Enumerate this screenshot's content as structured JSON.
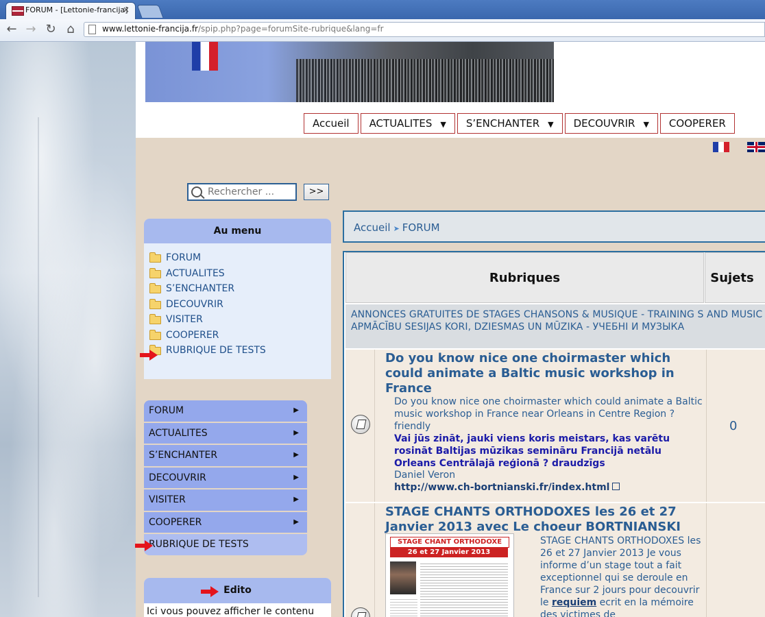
{
  "browser": {
    "tab_title": "FORUM - [Lettonie-francija]",
    "tab_close": "×",
    "url_host": "www.lettonie-francija.fr",
    "url_path": "/spip.php?page=forumSite-rubrique&lang=fr"
  },
  "main_menu": [
    {
      "label": "Accueil",
      "has_dropdown": false
    },
    {
      "label": "ACTUALITES",
      "has_dropdown": true
    },
    {
      "label": "S’ENCHANTER",
      "has_dropdown": true
    },
    {
      "label": "DECOUVRIR",
      "has_dropdown": true
    },
    {
      "label": "COOPERER",
      "has_dropdown": false
    }
  ],
  "dropdown_glyph": "▼",
  "search": {
    "placeholder": "Rechercher ...",
    "button_label": ">>"
  },
  "au_menu": {
    "title": "Au menu",
    "items": [
      "FORUM",
      "ACTUALITES",
      "S’ENCHANTER",
      "DECOUVRIR",
      "VISITER",
      "COOPERER",
      "RUBRIQUE DE TESTS"
    ]
  },
  "side_nav": {
    "items": [
      "FORUM",
      "ACTUALITES",
      "S’ENCHANTER",
      "DECOUVRIR",
      "VISITER",
      "COOPERER",
      "RUBRIQUE DE TESTS"
    ],
    "arrow_glyph": "▶"
  },
  "edito": {
    "title": "Edito",
    "text": "Ici vous pouvez afficher le contenu"
  },
  "breadcrumb": {
    "home": "Accueil",
    "current": "FORUM",
    "sep": "➤"
  },
  "forum": {
    "col_rubriques": "Rubriques",
    "col_sujets": "Sujets",
    "section_title": "ANNONCES GRATUITES DE STAGES CHANSONS & MUSIQUE - TRAINING S AND MUSIC - APMĀCĪBU SESIJAS KORI, DZIESMAS UN MŪZIKA - УЧЕБНІ И МУЗЫКА",
    "topics": [
      {
        "title": "Do you know nice one choirmaster which could animate a Baltic music workshop in France",
        "desc": "Do you know nice one choirmaster which could animate a Baltic music workshop in France near Orleans in Centre Region ? friendly",
        "desc_lv": "Vai jūs zināt, jauki viens koris meistars, kas varētu rosināt Baltijas mūzikas semināru Francijā netālu Orleans Centrālajā reģionā ? draudzīgs",
        "author": "Daniel Veron",
        "link": "http://www.ch-bortnianski.fr/index.html",
        "count": "0"
      },
      {
        "title": "STAGE CHANTS ORTHODOXES les 26 et 27 Janvier 2013 avec Le choeur BORTNIANSKI",
        "poster_title": "STAGE CHANT ORTHODOXE",
        "poster_date": "26 et 27 Janvier 2013",
        "desc_start": "STAGE CHANTS ORTHODOXES les 26 et 27 Janvier 2013 Je vous informe d’un stage tout a fait exceptionnel qui se deroule en France sur 2 jours pour decouvrir le ",
        "desc_link": "requiem",
        "desc_end": " ecrit en la mémoire des victimes de"
      }
    ]
  }
}
